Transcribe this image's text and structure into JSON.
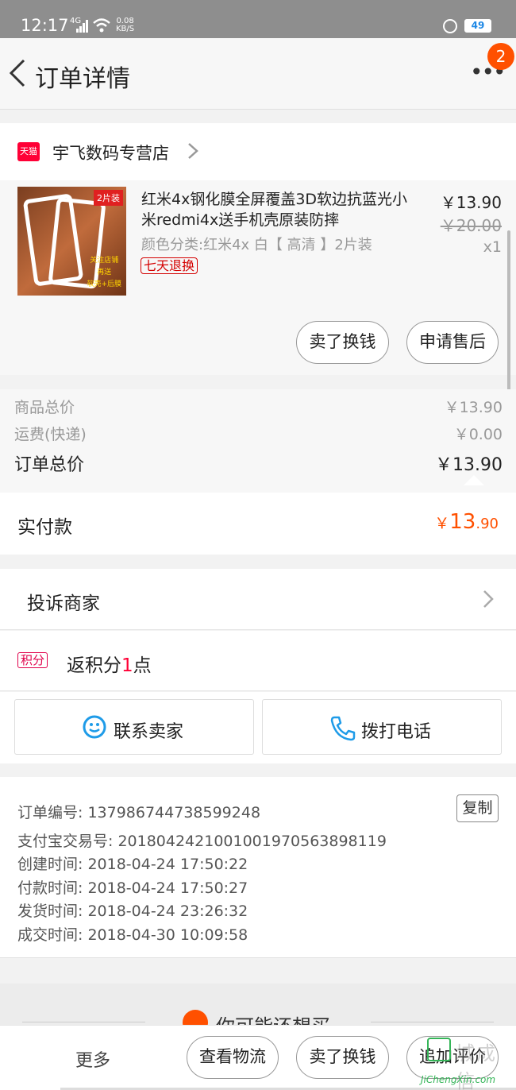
{
  "status_bar": {
    "time": "12:17",
    "network": "4G",
    "speed_value": "0.08",
    "speed_unit": "KB/S",
    "battery": "49"
  },
  "header": {
    "title": "订单详情",
    "more_label": "•••",
    "badge_count": "2"
  },
  "shop": {
    "platform_badge": "天猫",
    "name": "宇飞数码专营店"
  },
  "product": {
    "image_tag": "2片装",
    "image_promo": [
      "关注店铺",
      "再送",
      "软壳+后膜"
    ],
    "title": "红米4x钢化膜全屏覆盖3D软边抗蓝光小米redmi4x送手机壳原装防摔",
    "sku": "颜色分类:红米4x 白【 高清 】2片装",
    "return_badge": "七天退换",
    "price": "￥13.90",
    "original_price": "￥20.00",
    "quantity": "x1",
    "actions": {
      "sell_exchange": "卖了换钱",
      "after_sale": "申请售后"
    }
  },
  "summary": {
    "goods_total_label": "商品总价",
    "goods_total": "￥13.90",
    "shipping_label": "运费(快递)",
    "shipping": "￥0.00",
    "order_total_label": "订单总价",
    "order_total": "￥13.90"
  },
  "paid": {
    "label": "实付款",
    "currency": "￥",
    "integer": "13",
    "decimal": ".90"
  },
  "complain": {
    "label": "投诉商家"
  },
  "points": {
    "tag": "积分",
    "prefix": "返积分",
    "count": "1",
    "suffix": "点"
  },
  "contact": {
    "seller": "联系卖家",
    "call": "拨打电话"
  },
  "order_info": {
    "order_no": "订单编号: 1379867447385992​48",
    "copy_label": "复制",
    "alipay_no": "支付宝交易号: 2018042421001001970563898119",
    "created": "创建时间: 2018-04-24 17:50:22",
    "paid_time": "付款时间: 2018-04-24 17:50:27",
    "shipped": "发货时间: 2018-04-24 23:26:32",
    "completed": "成交时间: 2018-04-30 10:09:58"
  },
  "recommend": {
    "title": "你可能还想买"
  },
  "bottom_bar": {
    "more": "更多",
    "logistics": "查看物流",
    "sell_exchange": "卖了换钱",
    "add_review": "追加评价"
  },
  "watermark": {
    "text": "城成信",
    "url": "JiChengXin.com"
  },
  "colors": {
    "accent": "#ff5000",
    "tmall_red": "#ff0036",
    "badge": "#ff5000"
  }
}
